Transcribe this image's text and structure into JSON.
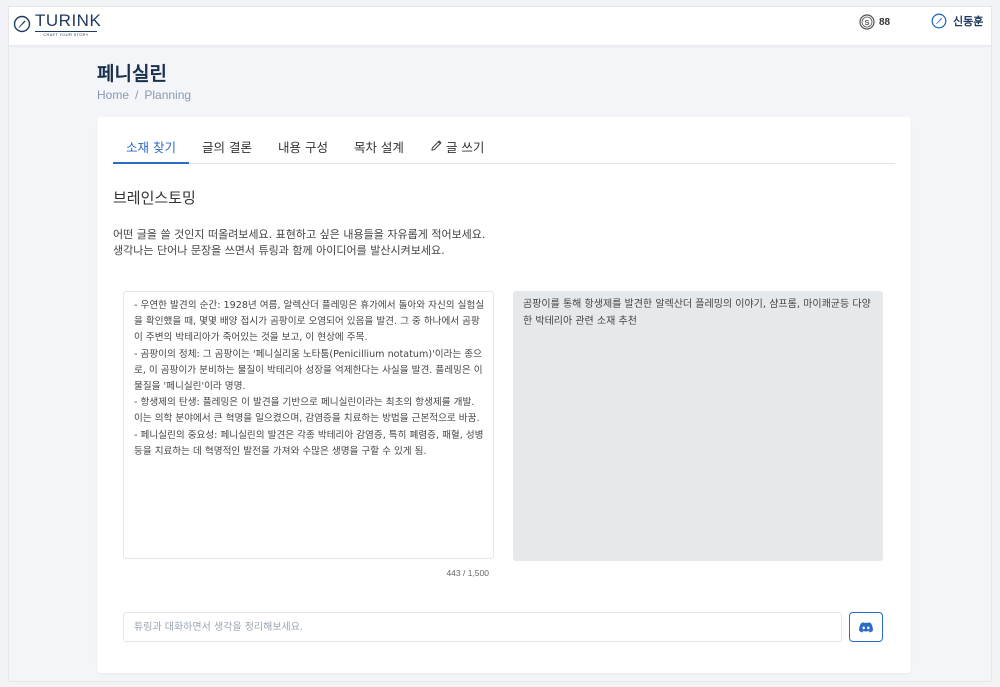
{
  "header": {
    "logo_text": "TURINK",
    "logo_tagline": "CRAFT YOUR STORY",
    "credits": "88",
    "user_name": "신동훈"
  },
  "page": {
    "title": "페니실린",
    "breadcrumb": [
      "Home",
      "/",
      "Planning"
    ]
  },
  "tabs": [
    {
      "label": "소재 찾기",
      "active": true
    },
    {
      "label": "글의 결론",
      "active": false
    },
    {
      "label": "내용 구성",
      "active": false
    },
    {
      "label": "목차 설계",
      "active": false
    },
    {
      "label": "글 쓰기",
      "active": false,
      "icon": "pencil-icon"
    }
  ],
  "brainstorm": {
    "title": "브레인스토밍",
    "desc_line1": "어떤 글을 쓸 것인지 떠올려보세요. 표현하고 싶은 내용들을 자유롭게 적어보세요.",
    "desc_line2": "생각나는 단어나 문장을 쓰면서 튜링과 함께 아이디어를 발산시켜보세요.",
    "editor_text": "- 우연한 발견의 순간: 1928년 여름, 알렉산더 플레밍은 휴가에서 돌아와 자신의 실험실을 확인했을 때, 몇몇 배양 접시가 곰팡이로 오염되어 있음을 발견. 그 중 하나에서 곰팡이 주변의 박테리아가 죽어있는 것을 보고, 이 현상에 주목.\n- 곰팡이의 정체: 그 곰팡이는 '페니실리움 노타툼(Penicillium notatum)'이라는 종으로, 이 곰팡이가 분비하는 물질이 박테리아 성장을 억제한다는 사실을 발견. 플레밍은 이 물질을 '페니실린'이라 명명.\n- 항생제의 탄생: 플레밍은 이 발견을 기반으로 페니실린이라는 최초의 항생제를 개발. 이는 의학 분야에서 큰 혁명을 일으켰으며, 감염증을 치료하는 방법을 근본적으로 바꿈.\n- 페니실린의 중요성: 페니실린의 발견은 각종 박테리아 감염증, 특히 폐렴증, 패혈, 성병 등을 치료하는 데 혁명적인 발전을 가져와 수많은 생명을 구할 수 있게 됨.",
    "char_count": "443 / 1,500",
    "suggestion_text": "곰팡이를 통해 항생제를 발견한 알렉산더 플레밍의 이야기, 샴프롬, 마이쾌균등 다양한 박테리아 관련 소재 추천"
  },
  "chat": {
    "placeholder": "튜링과 대화하면서 생각을 정리해보세요."
  },
  "colors": {
    "accent": "#2a6bc7",
    "navy": "#1e3a5f",
    "panel_gray": "#e6e9eb"
  }
}
